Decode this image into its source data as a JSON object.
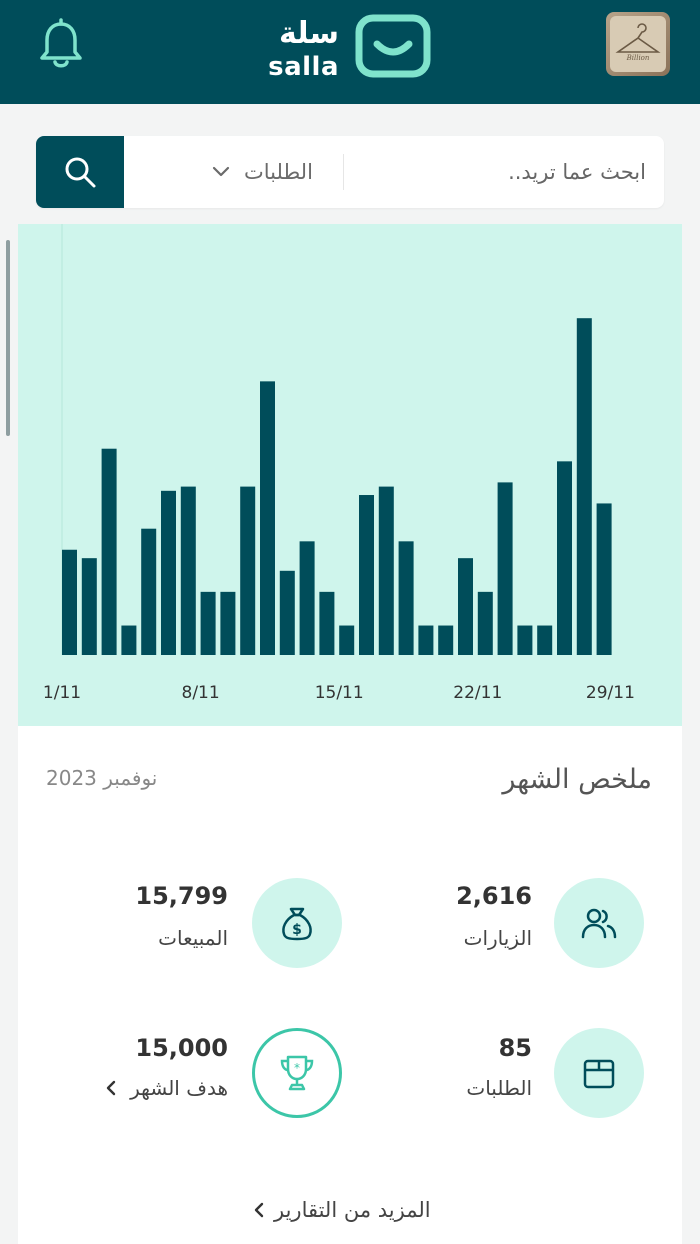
{
  "header": {
    "logo_ar": "سلة",
    "logo_en": "salla",
    "bell_icon": "bell-icon",
    "avatar_icon": "store-avatar"
  },
  "search": {
    "placeholder": "ابحث عما تريد..",
    "scope_label": "الطلبات",
    "search_icon": "search-icon"
  },
  "colors": {
    "brand": "#004d5a",
    "accent_light": "#cff5ec",
    "icon_teal": "#3cc6a8"
  },
  "chart_data": {
    "type": "bar",
    "x_ticks": [
      "1/11",
      "8/11",
      "15/11",
      "22/11",
      "29/11"
    ],
    "values": [
      2.5,
      2.3,
      4.9,
      0.7,
      3.0,
      3.9,
      4.0,
      1.5,
      1.5,
      4.0,
      6.5,
      2.0,
      2.7,
      1.5,
      0.7,
      3.8,
      4.0,
      2.7,
      0.7,
      0.7,
      2.3,
      1.5,
      4.1,
      0.7,
      0.7,
      4.6,
      8.0,
      3.6
    ],
    "ylim": [
      0,
      10
    ],
    "grid": false,
    "color": "#004d5a"
  },
  "summary": {
    "title": "ملخص الشهر",
    "month": "نوفمبر 2023",
    "visits": {
      "value": "2,616",
      "label": "الزيارات",
      "icon": "users-icon"
    },
    "sales": {
      "value": "15,799",
      "label": "المبيعات",
      "icon": "money-bag-icon"
    },
    "orders": {
      "value": "85",
      "label": "الطلبات",
      "icon": "box-icon"
    },
    "goal": {
      "value": "15,000",
      "label": "هدف الشهر",
      "icon": "trophy-icon"
    },
    "more_link": "المزيد من التقارير"
  }
}
